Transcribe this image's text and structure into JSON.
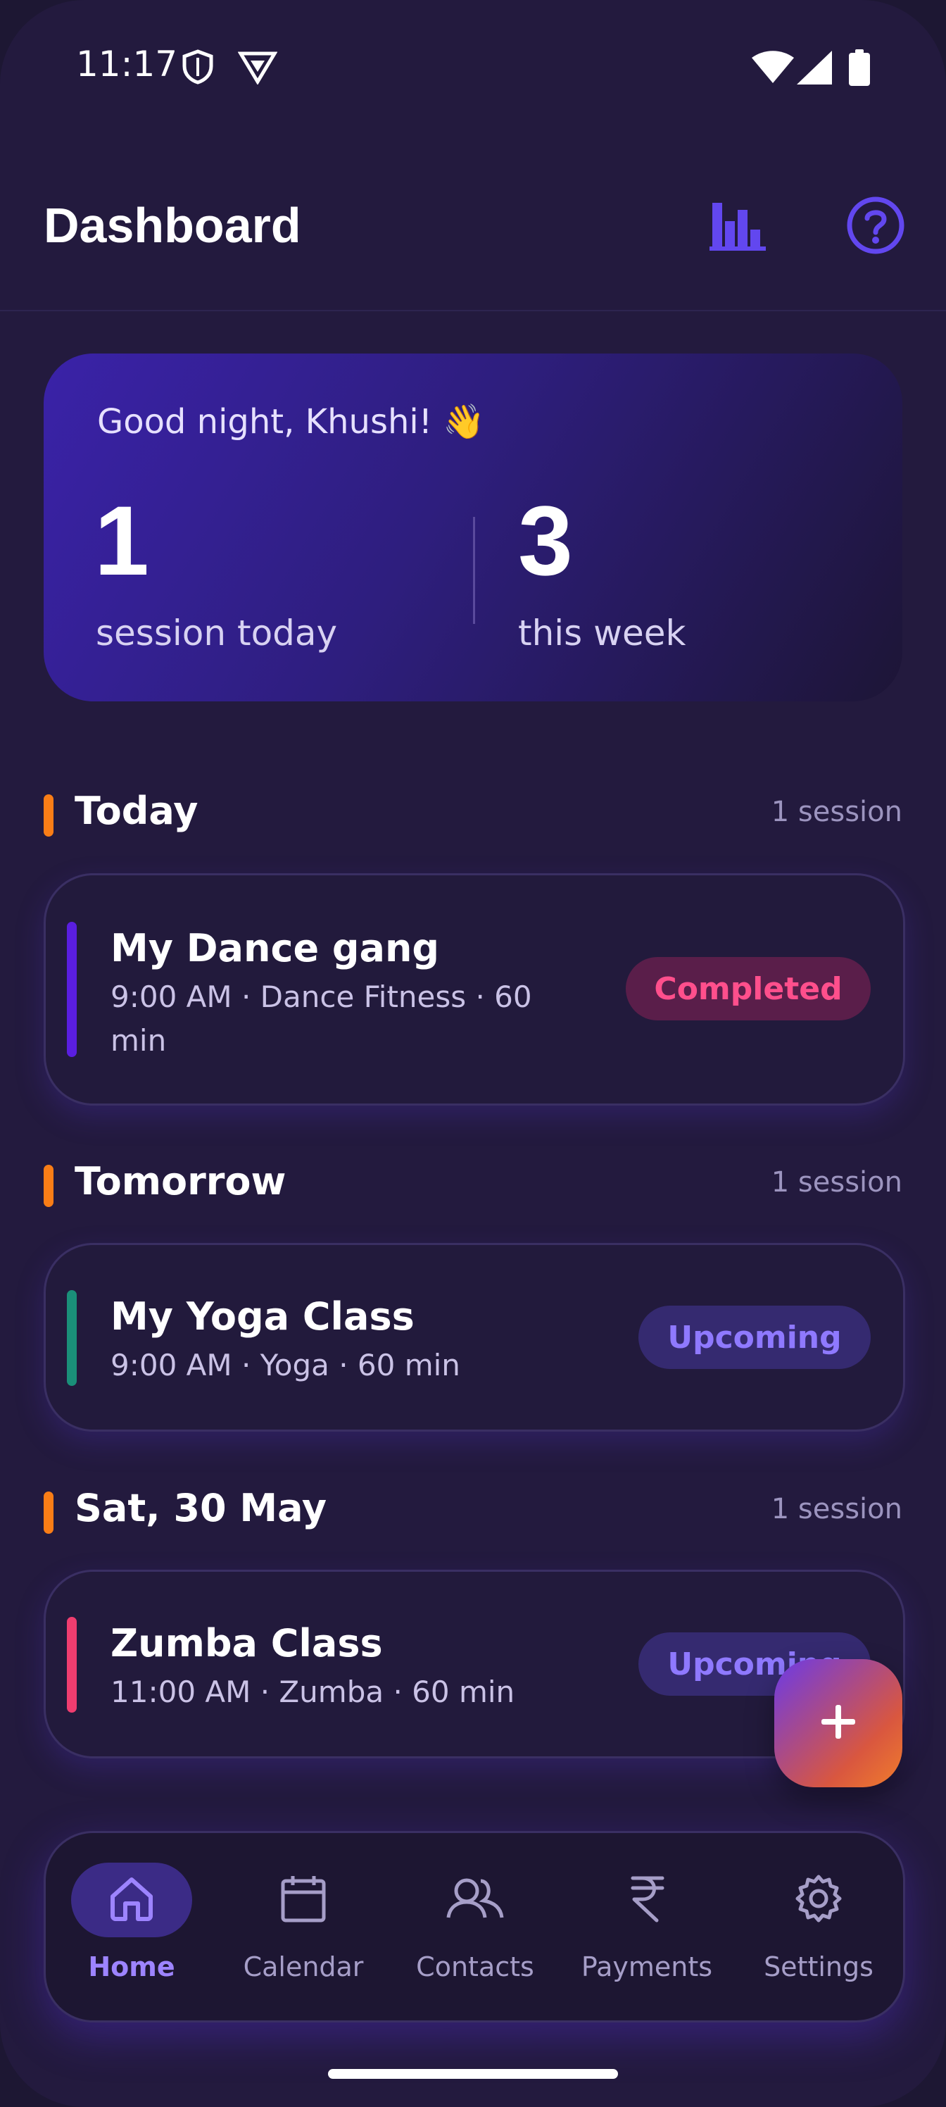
{
  "status_bar": {
    "time": "11:17"
  },
  "app_bar": {
    "title": "Dashboard"
  },
  "summary": {
    "greeting": "Good night, Khushi! 👋",
    "today_count": "1",
    "today_label": "session today",
    "week_count": "3",
    "week_label": "this week"
  },
  "sections": [
    {
      "title": "Today",
      "count": "1 session",
      "session": {
        "name": "My Dance gang",
        "meta_line1": "9:00 AM · Dance Fitness · 60",
        "meta_line2": "min",
        "status": "Completed",
        "stripe_color": "#5a1ee0"
      }
    },
    {
      "title": "Tomorrow",
      "count": "1 session",
      "session": {
        "name": "My Yoga Class",
        "meta_line1": "9:00 AM · Yoga · 60 min",
        "status": "Upcoming",
        "stripe_color": "#1a8f79"
      }
    },
    {
      "title": "Sat, 30 May",
      "count": "1 session",
      "session": {
        "name": "Zumba Class",
        "meta_line1": "11:00 AM · Zumba · 60 min",
        "status": "Upcoming",
        "stripe_color": "#ef3d6f"
      }
    }
  ],
  "bottom_nav": [
    {
      "label": "Home",
      "icon": "home-icon",
      "active": true
    },
    {
      "label": "Calendar",
      "icon": "calendar-icon",
      "active": false
    },
    {
      "label": "Contacts",
      "icon": "contacts-icon",
      "active": false
    },
    {
      "label": "Payments",
      "icon": "rupee-icon",
      "active": false
    },
    {
      "label": "Settings",
      "icon": "gear-icon",
      "active": false
    }
  ],
  "colors": {
    "accent": "#6c4cf0",
    "section_marker": "#f97d16",
    "completed": "#ff4f8c",
    "upcoming": "#8f79ff"
  }
}
